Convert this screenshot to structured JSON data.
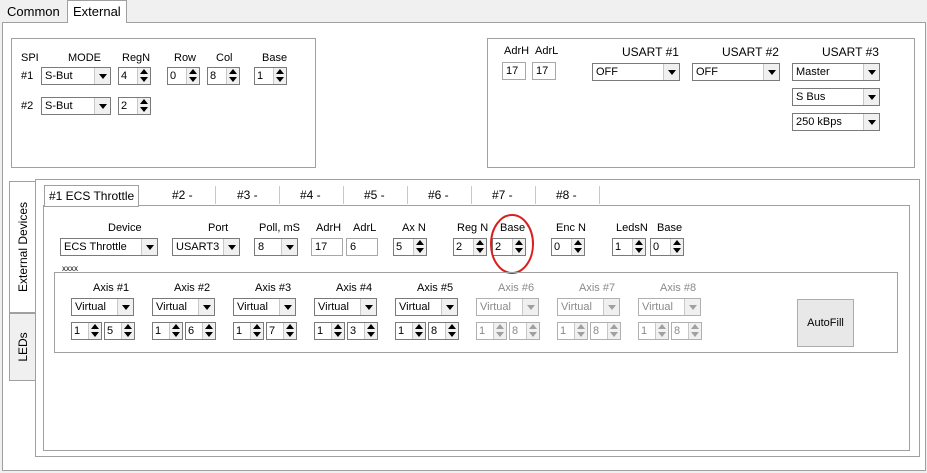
{
  "top_tabs": [
    "Common",
    "External"
  ],
  "spi": {
    "headers": {
      "spi": "SPI",
      "mode": "MODE",
      "regn": "RegN",
      "row": "Row",
      "col": "Col",
      "base": "Base"
    },
    "rows": [
      {
        "label": "#1",
        "mode": "S-But",
        "regn": "4",
        "row": "0",
        "col": "8",
        "base": "1"
      },
      {
        "label": "#2",
        "mode": "S-But",
        "regn": "2"
      }
    ]
  },
  "usart": {
    "adrh_label": "AdrH",
    "adrl_label": "AdrL",
    "adrh": "17",
    "adrl": "17",
    "u1_label": "USART #1",
    "u2_label": "USART #2",
    "u3_label": "USART #3",
    "u1": "OFF",
    "u2": "OFF",
    "u3_mode": "Master",
    "u3_bus": "S Bus",
    "u3_speed": "250 kBps"
  },
  "side_tabs": [
    "External Devices",
    "LEDs"
  ],
  "device_tabs": [
    "#1 ECS Throttle",
    "#2 -",
    "#3 -",
    "#4 -",
    "#5 -",
    "#6 -",
    "#7 -",
    "#8 -"
  ],
  "device": {
    "headers": {
      "device": "Device",
      "port": "Port",
      "poll": "Poll, mS",
      "adrh": "AdrH",
      "adrl": "AdrL",
      "axn": "Ax N",
      "regn": "Reg N",
      "base": "Base",
      "encn": "Enc N",
      "ledsn": "LedsN",
      "base2": "Base"
    },
    "device": "ECS Throttle",
    "port": "USART3",
    "poll": "8",
    "adrh": "17",
    "adrl": "6",
    "axn": "5",
    "regn": "2",
    "base": "2",
    "encn": "0",
    "ledsn": "1",
    "base2": "0"
  },
  "axes_group_label": "xxxx",
  "axes": [
    {
      "label": "Axis #1",
      "type": "Virtual",
      "a": "1",
      "b": "5",
      "enabled": true
    },
    {
      "label": "Axis #2",
      "type": "Virtual",
      "a": "1",
      "b": "6",
      "enabled": true
    },
    {
      "label": "Axis #3",
      "type": "Virtual",
      "a": "1",
      "b": "7",
      "enabled": true
    },
    {
      "label": "Axis #4",
      "type": "Virtual",
      "a": "1",
      "b": "3",
      "enabled": true
    },
    {
      "label": "Axis #5",
      "type": "Virtual",
      "a": "1",
      "b": "8",
      "enabled": true
    },
    {
      "label": "Axis #6",
      "type": "Virtual",
      "a": "1",
      "b": "8",
      "enabled": false
    },
    {
      "label": "Axis #7",
      "type": "Virtual",
      "a": "1",
      "b": "8",
      "enabled": false
    },
    {
      "label": "Axis #8",
      "type": "Virtual",
      "a": "1",
      "b": "8",
      "enabled": false
    }
  ],
  "autofill_label": "AutoFill",
  "colors": {
    "highlight_circle": "#d9201e",
    "window_bg": "#f0f0f0",
    "panel_bg": "#ffffff"
  }
}
